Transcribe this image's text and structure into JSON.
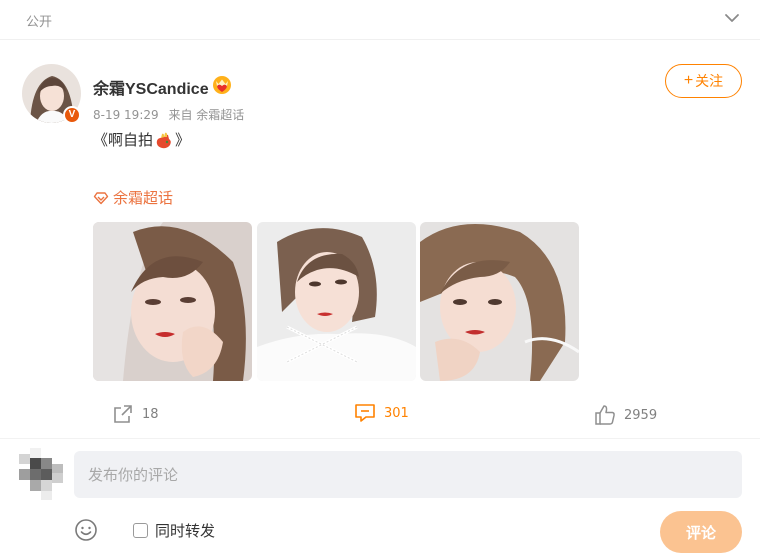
{
  "header": {
    "visibility": "公开",
    "collapse_icon": "chevron-down-icon"
  },
  "post": {
    "author": "余霜YSCandice",
    "verified_badge": "V",
    "vip_icon": "crown-heart-icon",
    "follow_label": "关注",
    "follow_icon": "plus-icon",
    "timestamp": "8-19 19:29",
    "source": "来自 余霜超话",
    "text_prefix": "《啊自拍",
    "text_emoji": "hand-emoji",
    "text_suffix": "》",
    "topic": "余霜超话",
    "topic_icon": "super-topic-icon",
    "images": [
      "photo-1",
      "photo-2",
      "photo-3"
    ]
  },
  "actions": {
    "repost_count": "18",
    "comment_count": "301",
    "like_count": "2959"
  },
  "composer": {
    "placeholder": "发布你的评论",
    "repost_label": "同时转发",
    "submit_label": "评论"
  },
  "colors": {
    "accent": "#ff8200",
    "topic": "#eb7340",
    "submit_disabled": "#fbc391",
    "input_bg": "#f0f1f4",
    "muted": "#939393"
  }
}
